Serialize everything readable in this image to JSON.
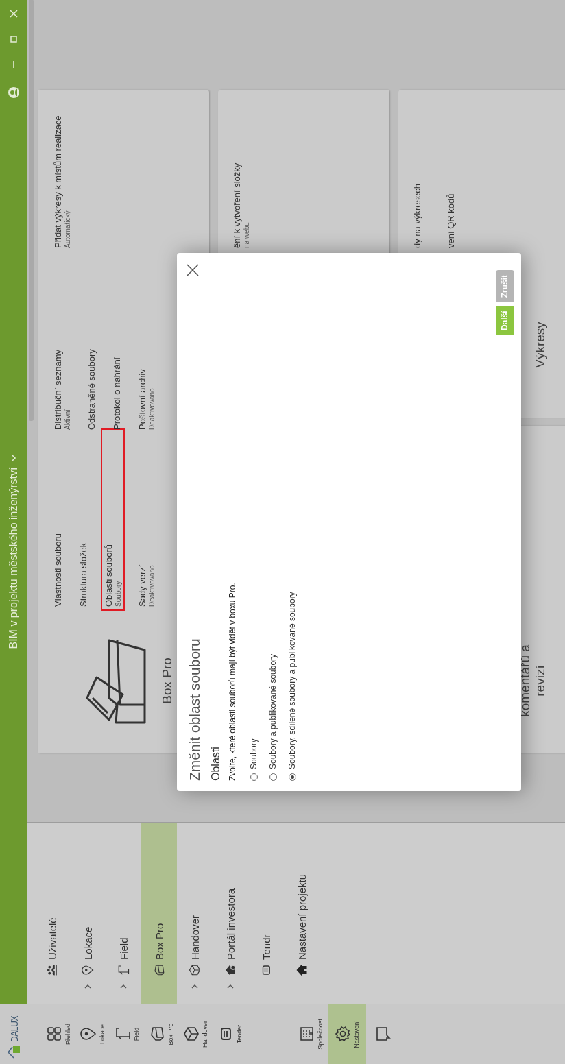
{
  "logo": {
    "text": "DALUX"
  },
  "header": {
    "title": "BIM v projektu městského inženýrství"
  },
  "nav_rail": {
    "top": [
      {
        "kind": "overview",
        "label": "Přehled",
        "selected": false
      },
      {
        "kind": "location",
        "label": "Lokace",
        "selected": false
      },
      {
        "kind": "field",
        "label": "Field",
        "selected": false
      },
      {
        "kind": "boxpro",
        "label": "Box Pro",
        "selected": false
      },
      {
        "kind": "handover",
        "label": "Handover",
        "selected": false
      },
      {
        "kind": "tender",
        "label": "Tender",
        "selected": false
      }
    ],
    "bottom": [
      {
        "kind": "company",
        "label": "Společnost",
        "selected": false
      },
      {
        "kind": "settings",
        "label": "Nastavení",
        "selected": true
      },
      {
        "kind": "support",
        "selected": false
      }
    ]
  },
  "sidebar": [
    {
      "kind": "users",
      "label": "Uživatelé",
      "expandable": false,
      "selected": false
    },
    {
      "kind": "location",
      "label": "Lokace",
      "expandable": true,
      "selected": false
    },
    {
      "kind": "field",
      "label": "Field",
      "expandable": true,
      "selected": false
    },
    {
      "kind": "boxpro",
      "label": "Box Pro",
      "expandable": false,
      "selected": true
    },
    {
      "kind": "handover",
      "label": "Handover",
      "expandable": true,
      "selected": false
    },
    {
      "kind": "portal",
      "label": "Portál investora",
      "expandable": true,
      "selected": false
    },
    {
      "kind": "tender",
      "label": "Tendr",
      "expandable": false,
      "selected": false
    },
    {
      "kind": "home",
      "label": "Nastavení projektu",
      "expandable": false,
      "selected": false
    }
  ],
  "box_pro_card": {
    "title": "Box Pro",
    "columns": [
      [
        {
          "label": "Vlastnosti souboru",
          "highlighted": false
        },
        {
          "label": "Struktura složek",
          "highlighted": false
        },
        {
          "label": "Oblasti souborů",
          "value": "Soubory",
          "highlighted": true
        },
        {
          "label": "Sady verzí",
          "value": "Deaktivováno",
          "highlighted": false
        }
      ],
      [
        {
          "label": "Distribuční seznamy",
          "value": "Aktivní",
          "highlighted": false
        },
        {
          "label": "Odstraněné soubory",
          "highlighted": false
        },
        {
          "label": "Protokol o nahrání",
          "highlighted": false
        },
        {
          "label": "Poštovní archiv",
          "value": "Deaktivováno",
          "highlighted": false
        }
      ],
      [
        {
          "label": "Přidat výkresy k místům realizace",
          "value": "Automatický",
          "highlighted": false
        }
      ]
    ]
  },
  "cards": [
    {
      "lines": [
        {
          "label": "ění k vytvoření složky",
          "value": "na webu"
        }
      ]
    },
    {
      "title": "komentářů a revizí"
    },
    {
      "title": "Výkresy",
      "lines": [
        {
          "label": "dy na výkresech"
        },
        {
          "label": "vení QR kódů"
        }
      ]
    }
  ],
  "dialog": {
    "title": "Změnit oblast souboru",
    "section": "Oblasti",
    "description": "Zvolte, které oblasti souborů mají být vidět v boxu Pro.",
    "options": [
      {
        "label": "Soubory",
        "selected": false
      },
      {
        "label": "Soubory a publikované soubory",
        "selected": false
      },
      {
        "label": "Soubory, sdílené soubory a publikované soubory",
        "selected": true
      }
    ],
    "buttons": [
      {
        "label": "Další",
        "kind": "primary"
      },
      {
        "label": "Zrušit",
        "kind": "secondary"
      }
    ]
  }
}
